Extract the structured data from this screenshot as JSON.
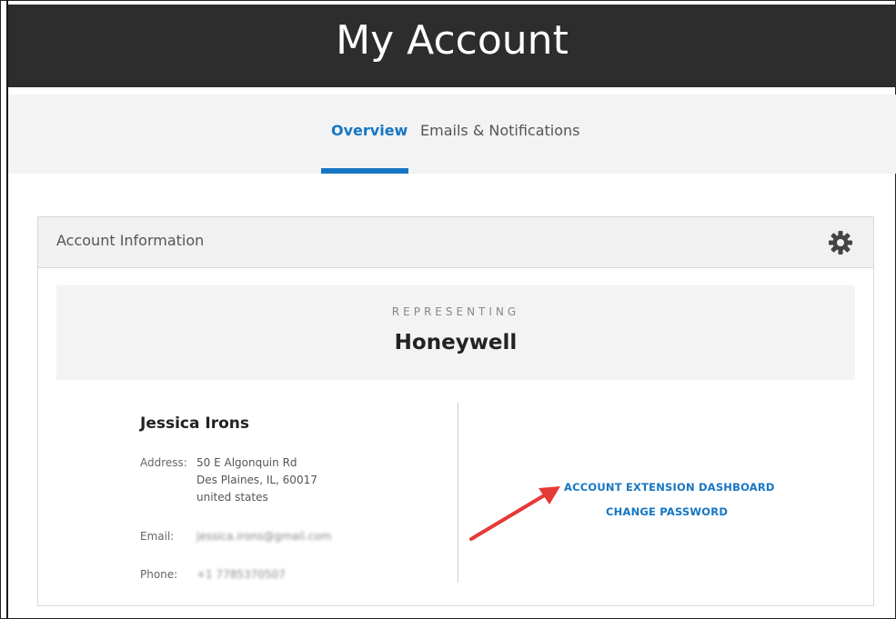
{
  "header": {
    "title": "My Account"
  },
  "tabs": [
    {
      "label": "Overview",
      "active": true
    },
    {
      "label": "Emails & Notifications",
      "active": false
    }
  ],
  "card": {
    "title": "Account Information",
    "settings_icon": "gear-icon"
  },
  "representing": {
    "label": "REPRESENTING",
    "company": "Honeywell"
  },
  "profile": {
    "name": "Jessica Irons",
    "address_label": "Address:",
    "address_line1": "50 E Algonquin Rd",
    "address_line2": "Des Plaines, IL, 60017",
    "address_line3": "united states",
    "email_label": "Email:",
    "email_value": "jessica.irons@gmail.com",
    "phone_label": "Phone:",
    "phone_value": "+1 7785370507"
  },
  "links": {
    "dashboard": "ACCOUNT EXTENSION DASHBOARD",
    "change_password": "CHANGE PASSWORD"
  },
  "colors": {
    "accent": "#1776c3",
    "header_bg": "#2d2d2d",
    "annotation_arrow": "#e53935"
  }
}
